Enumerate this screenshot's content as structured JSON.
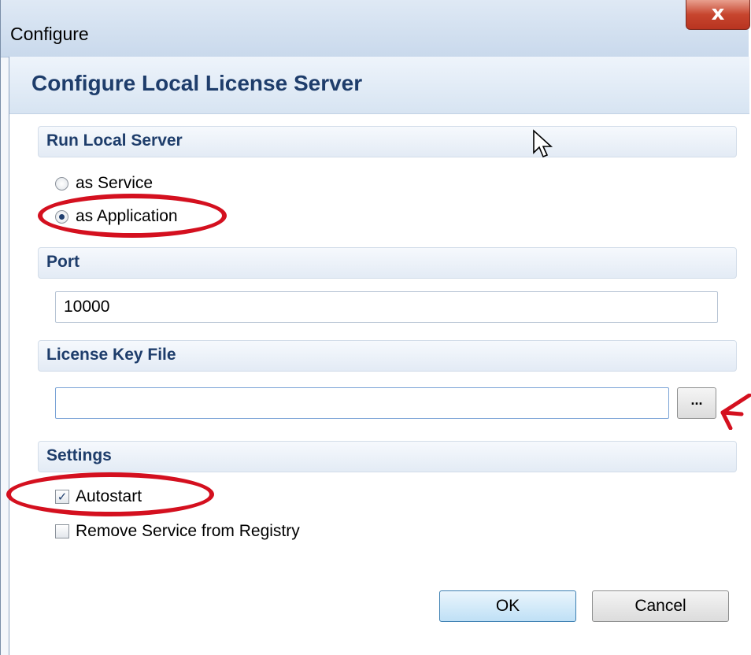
{
  "window": {
    "title": "Configure",
    "close_glyph": "x"
  },
  "header": {
    "title": "Configure Local License Server"
  },
  "run_local_server": {
    "heading": "Run Local Server",
    "options": [
      {
        "label": "as Service",
        "selected": false
      },
      {
        "label": "as Application",
        "selected": true
      }
    ]
  },
  "port": {
    "heading": "Port",
    "value": "10000"
  },
  "license_key_file": {
    "heading": "License Key File",
    "value": "",
    "browse_label": "..."
  },
  "settings": {
    "heading": "Settings",
    "checkboxes": [
      {
        "label": "Autostart",
        "checked": true
      },
      {
        "label": "Remove Service from Registry",
        "checked": false
      }
    ]
  },
  "buttons": {
    "ok": "OK",
    "cancel": "Cancel"
  },
  "colors": {
    "annotation": "#d4101f",
    "heading_text": "#1e3d6b"
  },
  "icons": {
    "close": "close-icon",
    "cursor": "mouse-pointer-icon",
    "annotation_arrow": "arrow-pointer-icon"
  }
}
